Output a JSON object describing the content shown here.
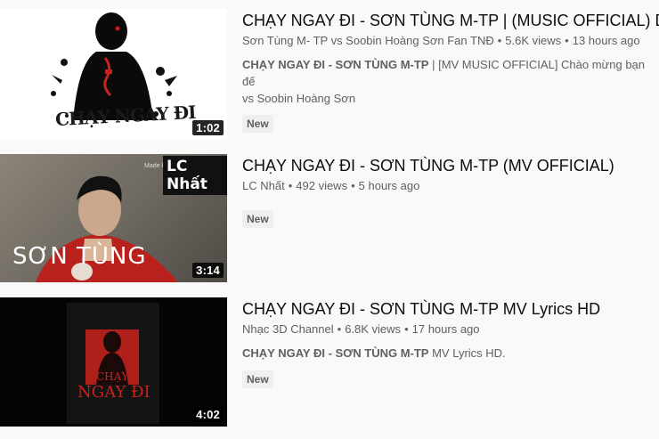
{
  "results": [
    {
      "title": "CHẠY NGAY ĐI - SƠN TÙNG M-TP | (MUSIC OFFICIAL) D",
      "channel": "Sơn Tùng M- TP vs Soobin Hoàng Sơn Fan TNĐ",
      "views": "5.6K views",
      "time": "13 hours ago",
      "desc_bold": "CHẠY NGAY ĐI - SƠN TÙNG M-TP",
      "desc_rest": " | [MV MUSIC OFFICIAL] Chào mừng bạn đế",
      "desc_line2": "vs Soobin Hoàng Sơn",
      "badge": "New",
      "duration": "1:02",
      "thumb_text": "CHẠY NGAY ĐI"
    },
    {
      "title": "CHẠY NGAY ĐI - SƠN TÙNG M-TP (MV OFFICIAL)",
      "channel": "LC Nhất",
      "views": "492 views",
      "time": "5 hours ago",
      "badge": "New",
      "duration": "3:14",
      "thumb_text": "SƠN TÙNG",
      "thumb_logo": "LC Nhất",
      "thumb_small": "Made by"
    },
    {
      "title": "CHẠY NGAY ĐI - SƠN TÙNG M-TP MV Lyrics HD",
      "channel": "Nhạc 3D Channel",
      "views": "6.8K views",
      "time": "17 hours ago",
      "desc_bold": "CHẠY NGAY ĐI - SƠN TÙNG M-TP",
      "desc_rest": " MV Lyrics HD.",
      "badge": "New",
      "duration": "4:02",
      "thumb_text_1": "CHẠY",
      "thumb_text_2": "NGAY ĐI"
    }
  ],
  "colors": {
    "background": "#f9f9f9",
    "title": "#0d0d0d",
    "meta": "#606060",
    "badge_bg": "#efefef",
    "accent_red": "#c8231d"
  },
  "icons": [
    "silhouette-art",
    "portrait-art",
    "poster-art"
  ]
}
